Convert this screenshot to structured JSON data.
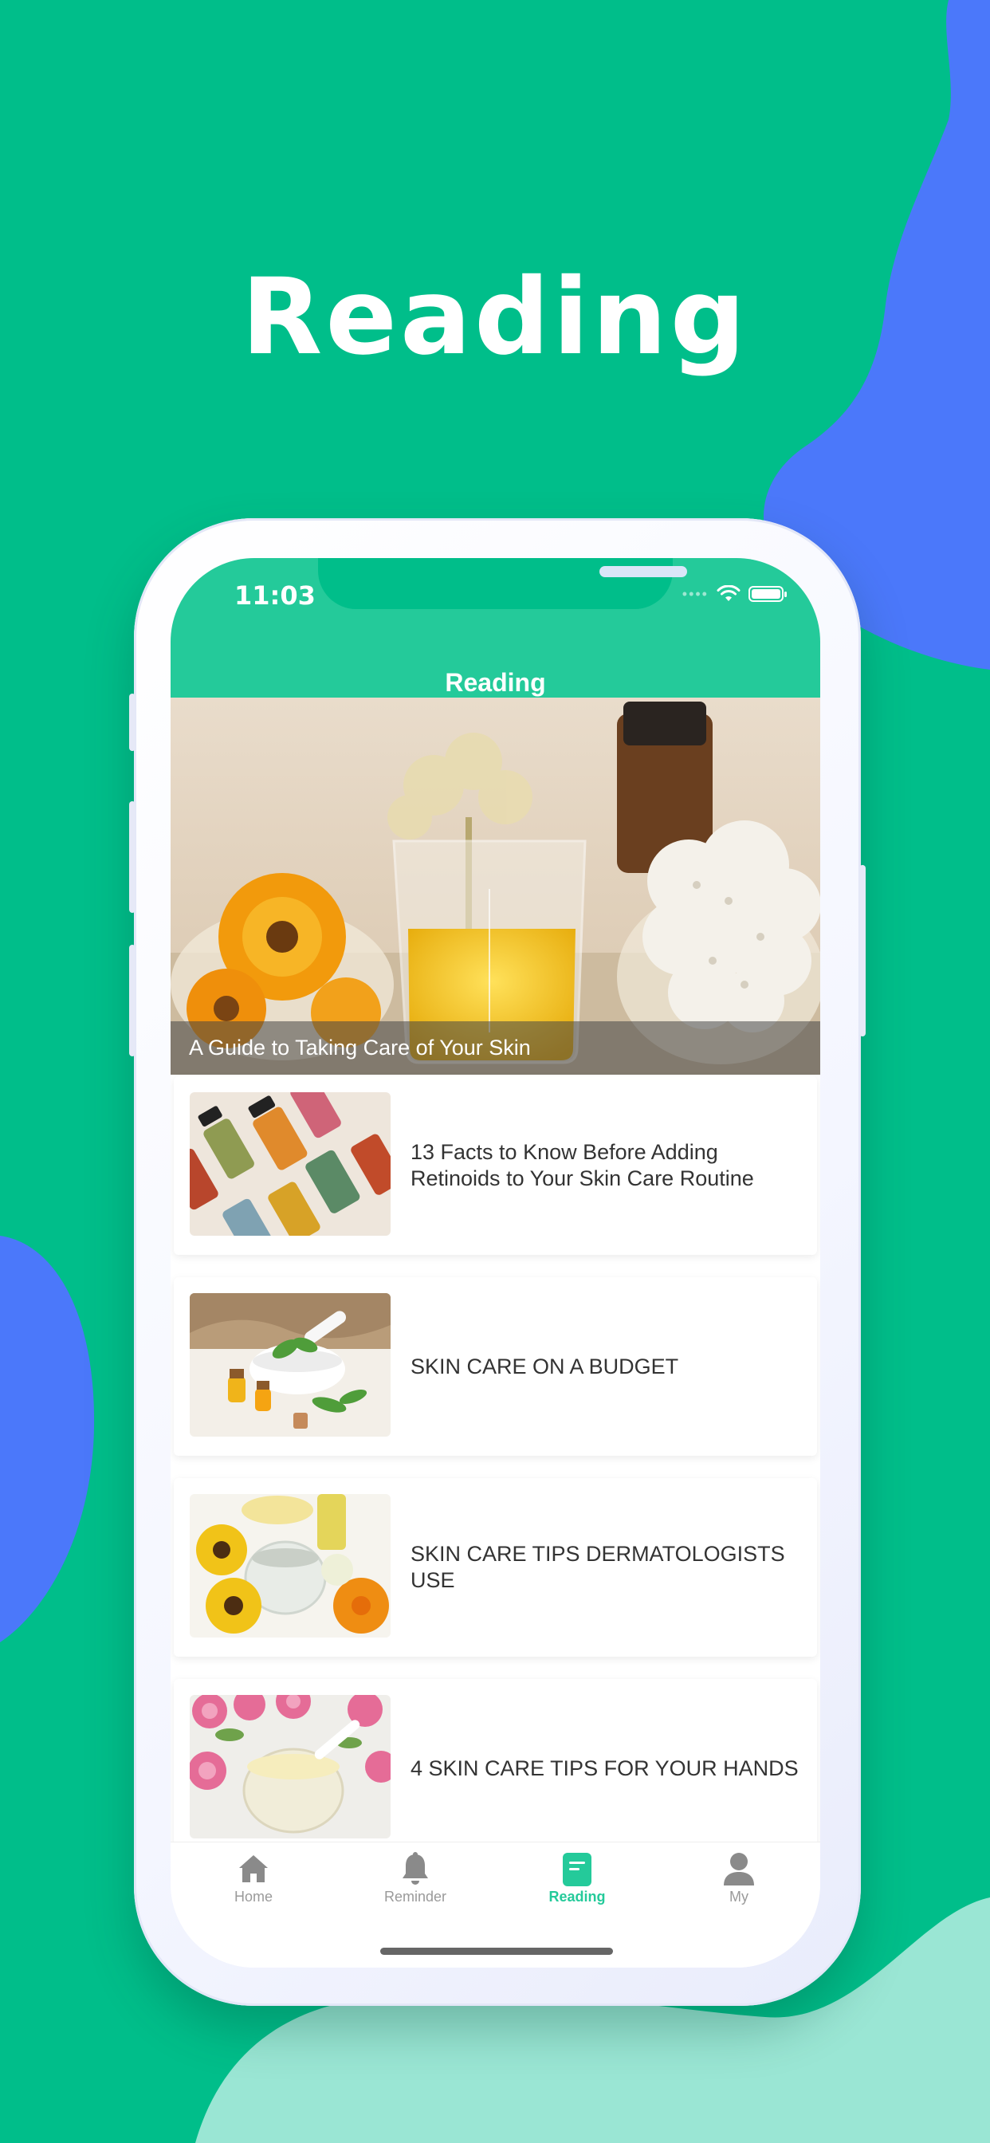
{
  "headline": "Reading",
  "colors": {
    "background": "#00BE8A",
    "accent_blue": "#4B78FA",
    "mint": "#9AE6D4",
    "app_green": "#24CA9A"
  },
  "status_bar": {
    "time": "11:03",
    "icons": [
      "wifi-icon",
      "battery-icon"
    ]
  },
  "nav": {
    "title": "Reading"
  },
  "hero": {
    "title": "A Guide to Taking Care of Your Skin",
    "image": "herbal-oils-with-flowers"
  },
  "articles": [
    {
      "title": "13 Facts to Know Before Adding Retinoids to Your Skin Care Routine",
      "image": "serum-bottles"
    },
    {
      "title": "SKIN CARE ON A BUDGET",
      "image": "mortar-and-essential-oils"
    },
    {
      "title": "SKIN CARE TIPS DERMATOLOGISTS USE",
      "image": "calendula-cream-jar"
    },
    {
      "title": "4 SKIN CARE TIPS FOR YOUR HANDS",
      "image": "rose-cream-jar"
    }
  ],
  "tabs": [
    {
      "label": "Home",
      "icon": "home-icon",
      "active": false
    },
    {
      "label": "Reminder",
      "icon": "bell-icon",
      "active": false
    },
    {
      "label": "Reading",
      "icon": "document-icon",
      "active": true
    },
    {
      "label": "My",
      "icon": "person-icon",
      "active": false
    }
  ]
}
